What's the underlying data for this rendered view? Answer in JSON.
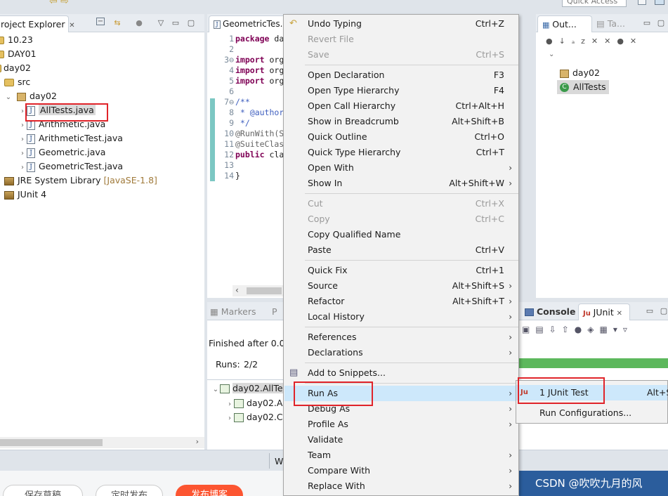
{
  "top": {
    "quick_access": "Quick Access"
  },
  "project_explorer": {
    "tab_title": "roject Explorer",
    "items": [
      {
        "label": "10.23",
        "kind": "project"
      },
      {
        "label": "DAY01",
        "kind": "project"
      },
      {
        "label": "day02",
        "kind": "project"
      },
      {
        "label": "src",
        "kind": "folder"
      },
      {
        "label": "day02",
        "kind": "package"
      },
      {
        "label": "AllTests.java",
        "kind": "java"
      },
      {
        "label": "Arithmetic.java",
        "kind": "java"
      },
      {
        "label": "ArithmeticTest.java",
        "kind": "java"
      },
      {
        "label": "Geometric.java",
        "kind": "java"
      },
      {
        "label": "GeometricTest.java",
        "kind": "java"
      },
      {
        "label": "JRE System Library",
        "suffix": "[JavaSE-1.8]",
        "kind": "library"
      },
      {
        "label": "JUnit 4",
        "kind": "library"
      }
    ]
  },
  "editor": {
    "tab_title": "GeometricTes...",
    "line_numbers": [
      "1",
      "2",
      "3⊖",
      "4",
      "5",
      "6",
      "7⊖",
      "8",
      "9",
      "10",
      "11",
      "12",
      "13",
      "14"
    ],
    "lines": [
      {
        "text": "package da",
        "kw": "package",
        "rest": " da"
      },
      {
        "text": "",
        "kw": "",
        "rest": ""
      },
      {
        "text": "import org",
        "kw": "import",
        "rest": " org"
      },
      {
        "text": "import org",
        "kw": "import",
        "rest": " org"
      },
      {
        "text": "import org",
        "kw": "import",
        "rest": " org"
      },
      {
        "text": "",
        "kw": "",
        "rest": ""
      },
      {
        "text": "/**",
        "kw": "",
        "rest": "/**",
        "comment": true
      },
      {
        "text": " * @author",
        "kw": "",
        "rest": " * @author",
        "comment": true
      },
      {
        "text": " */",
        "kw": "",
        "rest": " */",
        "comment": true
      },
      {
        "text": "@RunWith(S",
        "kw": "",
        "rest": "@RunWith(S",
        "ann": true
      },
      {
        "text": "@SuiteClas",
        "kw": "",
        "rest": "@SuiteClas",
        "ann": true
      },
      {
        "text": "public cla",
        "kw": "public",
        "rest": " cla"
      },
      {
        "text": "",
        "kw": "",
        "rest": ""
      },
      {
        "text": "}",
        "kw": "",
        "rest": "}"
      }
    ]
  },
  "outline": {
    "tabs": [
      "Out...",
      "Ta..."
    ],
    "items": [
      "day02",
      "AllTests"
    ]
  },
  "bottom_left": {
    "tabs": [
      "Markers",
      "P"
    ],
    "finished_text": "Finished after 0.01",
    "runs_label": "Runs:",
    "runs_value": "2/2",
    "tree": [
      "day02.AllTe",
      "day02.A",
      "day02.C"
    ]
  },
  "junit_panel": {
    "tabs": [
      "Console",
      "JUnit"
    ]
  },
  "status_bar": {
    "text": "W"
  },
  "context_menu": {
    "items": [
      {
        "label": "Undo Typing",
        "shortcut": "Ctrl+Z",
        "disabled": false,
        "icon": "undo-icon"
      },
      {
        "label": "Revert File",
        "shortcut": "",
        "disabled": true
      },
      {
        "label": "Save",
        "shortcut": "Ctrl+S",
        "disabled": true
      },
      {
        "sep": true
      },
      {
        "label": "Open Declaration",
        "shortcut": "F3"
      },
      {
        "label": "Open Type Hierarchy",
        "shortcut": "F4"
      },
      {
        "label": "Open Call Hierarchy",
        "shortcut": "Ctrl+Alt+H"
      },
      {
        "label": "Show in Breadcrumb",
        "shortcut": "Alt+Shift+B"
      },
      {
        "label": "Quick Outline",
        "shortcut": "Ctrl+O"
      },
      {
        "label": "Quick Type Hierarchy",
        "shortcut": "Ctrl+T"
      },
      {
        "label": "Open With",
        "shortcut": "",
        "submenu": true
      },
      {
        "label": "Show In",
        "shortcut": "Alt+Shift+W",
        "submenu": true
      },
      {
        "sep": true
      },
      {
        "label": "Cut",
        "shortcut": "Ctrl+X",
        "disabled": true
      },
      {
        "label": "Copy",
        "shortcut": "Ctrl+C",
        "disabled": true
      },
      {
        "label": "Copy Qualified Name",
        "shortcut": ""
      },
      {
        "label": "Paste",
        "shortcut": "Ctrl+V"
      },
      {
        "sep": true
      },
      {
        "label": "Quick Fix",
        "shortcut": "Ctrl+1"
      },
      {
        "label": "Source",
        "shortcut": "Alt+Shift+S",
        "submenu": true
      },
      {
        "label": "Refactor",
        "shortcut": "Alt+Shift+T",
        "submenu": true
      },
      {
        "label": "Local History",
        "shortcut": "",
        "submenu": true
      },
      {
        "sep": true
      },
      {
        "label": "References",
        "shortcut": "",
        "submenu": true
      },
      {
        "label": "Declarations",
        "shortcut": "",
        "submenu": true
      },
      {
        "sep": true
      },
      {
        "label": "Add to Snippets...",
        "shortcut": "",
        "icon": "snippet-icon"
      },
      {
        "sep": true
      },
      {
        "label": "Run As",
        "shortcut": "",
        "submenu": true,
        "highlighted": true
      },
      {
        "label": "Debug As",
        "shortcut": "",
        "submenu": true
      },
      {
        "label": "Profile As",
        "shortcut": "",
        "submenu": true
      },
      {
        "label": "Validate",
        "shortcut": ""
      },
      {
        "label": "Team",
        "shortcut": "",
        "submenu": true
      },
      {
        "label": "Compare With",
        "shortcut": "",
        "submenu": true
      },
      {
        "label": "Replace With",
        "shortcut": "",
        "submenu": true
      }
    ]
  },
  "run_as_submenu": {
    "items": [
      {
        "label": "1 JUnit Test",
        "shortcut": "Alt+S",
        "highlighted": true
      },
      {
        "label": "Run Configurations..."
      }
    ]
  },
  "watermark": "CSDN @吹吹九月的风",
  "bottom_buttons": [
    "保存草稿",
    "定时发布",
    "发布博客"
  ],
  "colors": {
    "menu_highlight": "#cde8fb",
    "red_box": "#e0242a",
    "junit_green": "#5cb85c",
    "publish_orange": "#fc5531",
    "watermark_bg": "#2b5d9c"
  }
}
